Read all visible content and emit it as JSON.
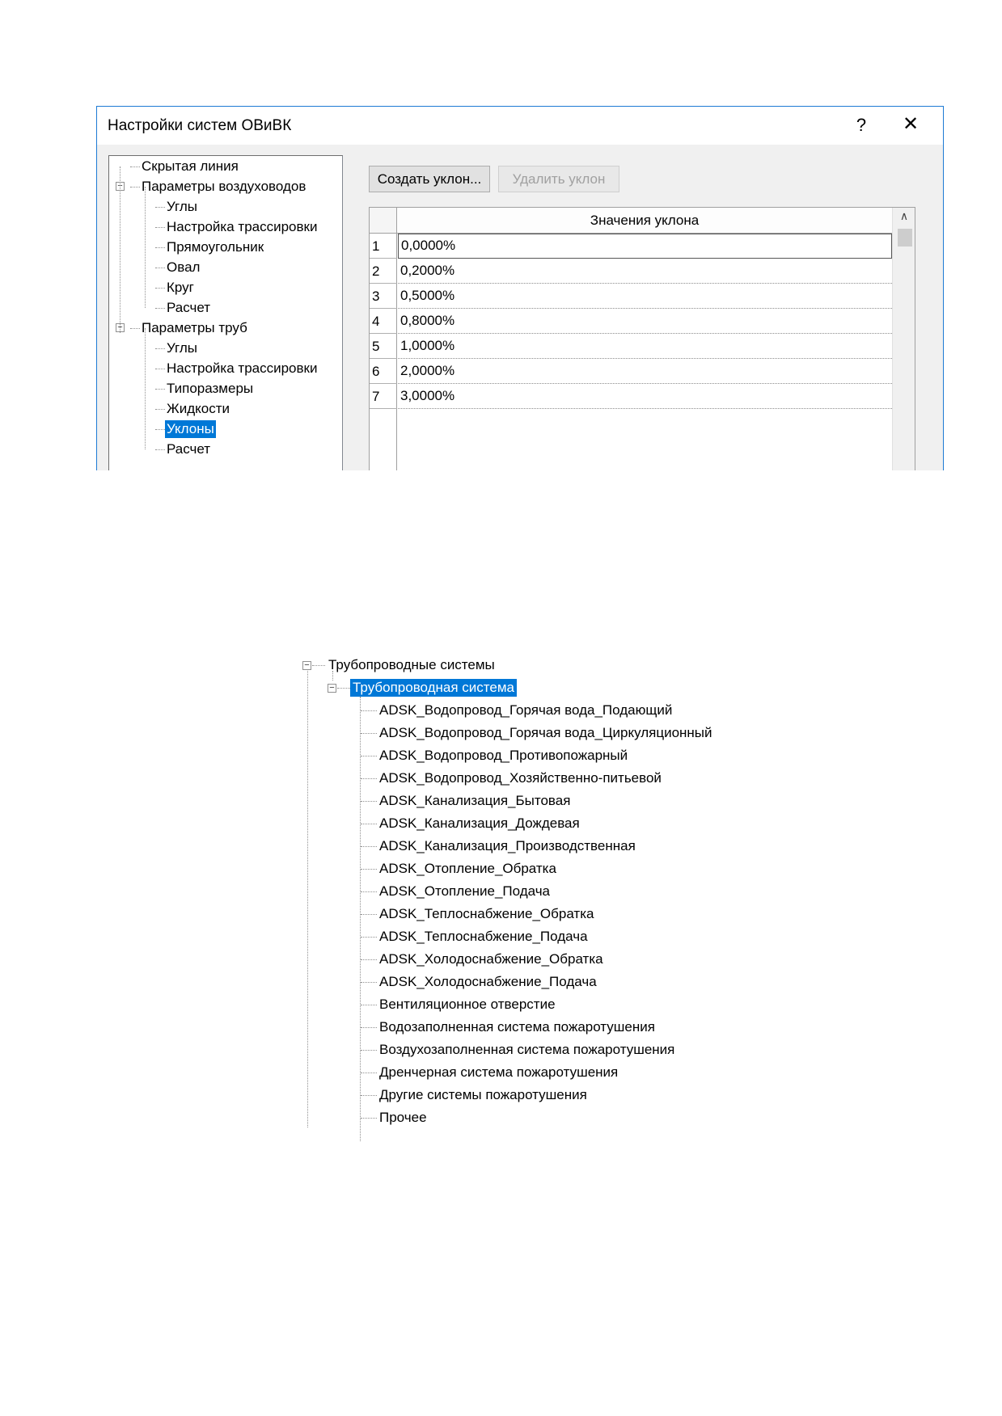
{
  "dialog": {
    "title": "Настройки систем ОВиВК",
    "help_label": "?",
    "close_label": "✕",
    "tree": [
      {
        "label": "Скрытая линия",
        "level": 0,
        "expander": ""
      },
      {
        "label": "Параметры воздуховодов",
        "level": 0,
        "expander": "−"
      },
      {
        "label": "Углы",
        "level": 1,
        "expander": ""
      },
      {
        "label": "Настройка трассировки",
        "level": 1,
        "expander": ""
      },
      {
        "label": "Прямоугольник",
        "level": 1,
        "expander": ""
      },
      {
        "label": "Овал",
        "level": 1,
        "expander": ""
      },
      {
        "label": "Круг",
        "level": 1,
        "expander": ""
      },
      {
        "label": "Расчет",
        "level": 1,
        "expander": ""
      },
      {
        "label": "Параметры труб",
        "level": 0,
        "expander": "−"
      },
      {
        "label": "Углы",
        "level": 1,
        "expander": ""
      },
      {
        "label": "Настройка трассировки",
        "level": 1,
        "expander": ""
      },
      {
        "label": "Типоразмеры",
        "level": 1,
        "expander": ""
      },
      {
        "label": "Жидкости",
        "level": 1,
        "expander": ""
      },
      {
        "label": "Уклоны",
        "level": 1,
        "expander": "",
        "selected": true
      },
      {
        "label": "Расчет",
        "level": 1,
        "expander": ""
      }
    ],
    "create_slope_label": "Создать уклон...",
    "delete_slope_label": "Удалить уклон",
    "grid": {
      "column_header": "Значения уклона",
      "rows": [
        {
          "num": "1",
          "value": "0,0000%"
        },
        {
          "num": "2",
          "value": "0,2000%"
        },
        {
          "num": "3",
          "value": "0,5000%"
        },
        {
          "num": "4",
          "value": "0,8000%"
        },
        {
          "num": "5",
          "value": "1,0000%"
        },
        {
          "num": "6",
          "value": "2,0000%"
        },
        {
          "num": "7",
          "value": "3,0000%"
        }
      ],
      "scroll_up_icon": "chevron-up-icon",
      "scroll_up_glyph": "∧"
    }
  },
  "piping_tree": {
    "root_label": "Трубопроводные системы",
    "expander": "−",
    "system_label": "Трубопроводная система",
    "items": [
      "ADSK_Водопровод_Горячая вода_Подающий",
      "ADSK_Водопровод_Горячая вода_Циркуляционный",
      "ADSK_Водопровод_Противопожарный",
      "ADSK_Водопровод_Хозяйственно-питьевой",
      "ADSK_Канализация_Бытовая",
      "ADSK_Канализация_Дождевая",
      "ADSK_Канализация_Производственная",
      "ADSK_Отопление_Обратка",
      "ADSK_Отопление_Подача",
      "ADSK_Теплоснабжение_Обратка",
      "ADSK_Теплоснабжение_Подача",
      "ADSK_Холодоснабжение_Обратка",
      "ADSK_Холодоснабжение_Подача",
      "Вентиляционное отверстие",
      "Водозаполненная система пожаротушения",
      "Воздухозаполненная система пожаротушения",
      "Дренчерная система пожаротушения",
      "Другие системы пожаротушения",
      "Прочее"
    ]
  }
}
